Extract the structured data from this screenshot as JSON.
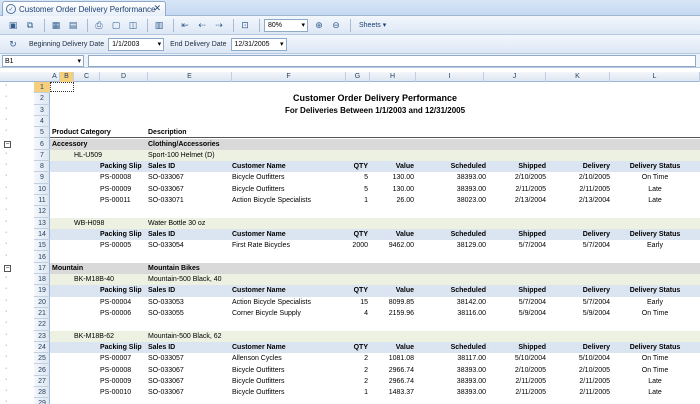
{
  "tab": {
    "title": "Customer Order Delivery Performance",
    "close": "✕"
  },
  "toolbar": {
    "zoom": "80%",
    "sheets_label": "Sheets",
    "begin_label": "Beginning Delivery Date",
    "begin_value": "1/1/2003",
    "end_label": "End Delivery Date",
    "end_value": "12/31/2005"
  },
  "namebox": {
    "value": "B1"
  },
  "columns": [
    "A",
    "B",
    "C",
    "D",
    "E",
    "F",
    "G",
    "H",
    "I",
    "J",
    "K",
    "L"
  ],
  "outline_levels": [
    "1",
    "2"
  ],
  "row_numbers": [
    "1",
    "2",
    "3",
    "4",
    "5",
    "6",
    "7",
    "8",
    "9",
    "10",
    "11",
    "12",
    "13",
    "14",
    "15",
    "16",
    "17",
    "18",
    "19",
    "20",
    "21",
    "22",
    "23",
    "24",
    "25",
    "26",
    "27",
    "28",
    "29"
  ],
  "report": {
    "title": "Customer Order Delivery Performance",
    "subtitle": "For Deliveries Between  1/1/2003  and  12/31/2005",
    "col_product_category": "Product Category",
    "col_description": "Description",
    "detail_headers": {
      "packing_slip": "Packing Slip",
      "sales_id": "Sales ID",
      "customer_name": "Customer Name",
      "qty": "QTY",
      "value": "Value",
      "scheduled": "Scheduled",
      "shipped": "Shipped",
      "delivery": "Delivery",
      "delivery_status": "Delivery Status"
    },
    "categories": [
      {
        "name": "Accessory",
        "description": "Clothing/Accessories",
        "products": [
          {
            "code": "HL-U509",
            "description": "Sport-100 Helmet (D)",
            "rows": [
              [
                "PS-00008",
                "SO-033067",
                "Bicycle Outfitters",
                "5",
                "130.00",
                "38393.00",
                "2/10/2005",
                "2/10/2005",
                "On Time"
              ],
              [
                "PS-00009",
                "SO-033067",
                "Bicycle Outfitters",
                "5",
                "130.00",
                "38393.00",
                "2/11/2005",
                "2/11/2005",
                "Late"
              ],
              [
                "PS-00011",
                "SO-033071",
                "Action Bicycle Specialists",
                "1",
                "26.00",
                "38023.00",
                "2/13/2004",
                "2/13/2004",
                "Late"
              ]
            ]
          },
          {
            "code": "WB-H098",
            "description": "Water Bottle 30 oz",
            "rows": [
              [
                "PS-00005",
                "SO-033054",
                "First Rate Bicycles",
                "2000",
                "9462.00",
                "38129.00",
                "5/7/2004",
                "5/7/2004",
                "Early"
              ]
            ]
          }
        ]
      },
      {
        "name": "Mountain",
        "description": "Mountain Bikes",
        "products": [
          {
            "code": "BK-M18B-40",
            "description": "Mountain-500 Black, 40",
            "rows": [
              [
                "PS-00004",
                "SO-033053",
                "Action Bicycle Specialists",
                "15",
                "8099.85",
                "38142.00",
                "5/7/2004",
                "5/7/2004",
                "Early"
              ],
              [
                "PS-00006",
                "SO-033055",
                "Corner Bicycle Supply",
                "4",
                "2159.96",
                "38116.00",
                "5/9/2004",
                "5/9/2004",
                "On Time"
              ]
            ]
          },
          {
            "code": "BK-M18B-62",
            "description": "Mountain-500 Black, 62",
            "rows": [
              [
                "PS-00007",
                "SO-033057",
                "Allenson Cycles",
                "2",
                "1081.08",
                "38117.00",
                "5/10/2004",
                "5/10/2004",
                "On Time"
              ],
              [
                "PS-00008",
                "SO-033067",
                "Bicycle Outfitters",
                "2",
                "2966.74",
                "38393.00",
                "2/10/2005",
                "2/10/2005",
                "On Time"
              ],
              [
                "PS-00009",
                "SO-033067",
                "Bicycle Outfitters",
                "2",
                "2966.74",
                "38393.00",
                "2/11/2005",
                "2/11/2005",
                "Late"
              ],
              [
                "PS-00010",
                "SO-033067",
                "Bicycle Outfitters",
                "1",
                "1483.37",
                "38393.00",
                "2/11/2005",
                "2/11/2005",
                "Late"
              ]
            ]
          }
        ]
      }
    ]
  }
}
